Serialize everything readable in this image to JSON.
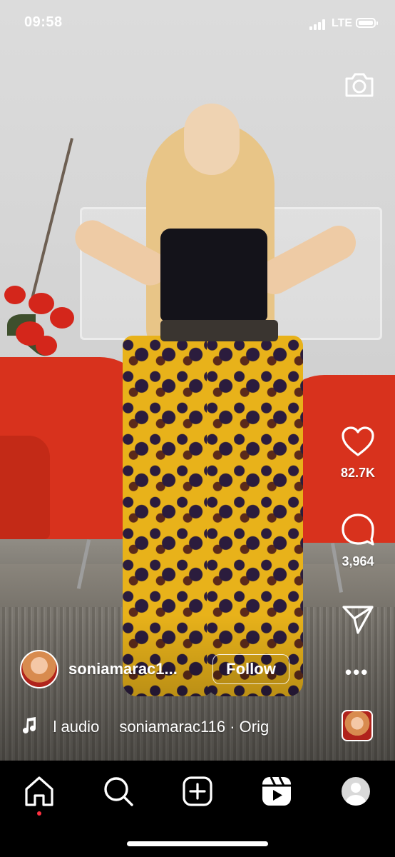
{
  "status_bar": {
    "time": "09:58",
    "network": "LTE"
  },
  "reel": {
    "likes_count": "82.7K",
    "comments_count": "3,964",
    "username": "soniamarac1...",
    "follow_label": "Follow",
    "more_label": "•••",
    "audio_part1": "nal audio",
    "audio_part2": "soniamarac116 · Orig"
  },
  "icons": {
    "camera": "camera-icon",
    "like": "heart-icon",
    "comment": "comment-icon",
    "share": "send-icon",
    "audio": "music-note-icon",
    "nav": [
      "home-icon",
      "search-icon",
      "create-icon",
      "reels-icon",
      "profile-icon"
    ]
  },
  "colors": {
    "accent": "#ff3040",
    "nav_background": "#000000",
    "overlay_text": "#ffffff"
  }
}
